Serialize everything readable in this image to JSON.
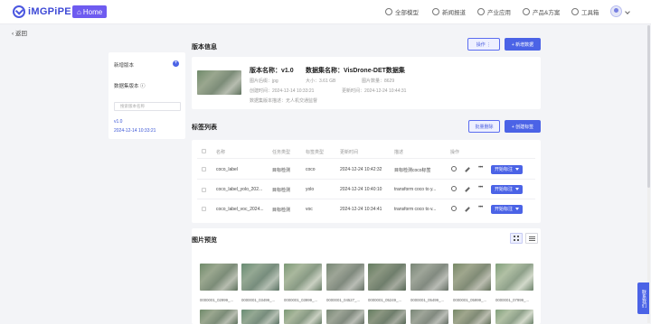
{
  "header": {
    "logo": "iMGPiPE",
    "home": "Home",
    "nav": [
      "全部模型",
      "新闻报道",
      "产业应用",
      "产品&方案",
      "工具箱"
    ]
  },
  "back": "返回",
  "sidebar": {
    "new_version": "新增版本",
    "dataset_version": "数据集版本 ⓘ",
    "search_placeholder": "搜索版本名称",
    "version": "v1.0",
    "version_time": "2024-12-14 10:33:21"
  },
  "version_info": {
    "title": "版本信息",
    "btn_action": "操作 ⋮",
    "btn_add": "+ 新增数据",
    "name": "版本名称：v1.0",
    "dataset": "数据集名称：VisDrone-DET数据集",
    "format": "图片后缀：jpg",
    "size": "大小：3.61 GB",
    "count": "图片数量：8629",
    "created": "创建时间：2024-12-14 10:33:21",
    "updated": "更新时间：2024-12-24 10:44:31",
    "desc": "数据集版本描述：无人机交通监督"
  },
  "labels": {
    "title": "标签列表",
    "btn_batch": "批量删除",
    "btn_create": "+ 创建标签",
    "columns": [
      "名称",
      "任务类型",
      "标签类型",
      "更新时间",
      "描述",
      "操作"
    ],
    "rows": [
      {
        "name": "coco_label",
        "task": "目标检测",
        "type": "coco",
        "time": "2024-12-24 10:42:32",
        "desc": "目标检测coco标签",
        "action": "开始标注"
      },
      {
        "name": "coco_label_yolo_202...",
        "task": "目标检测",
        "type": "yolo",
        "time": "2024-12-24 10:40:10",
        "desc": "transform coco to y...",
        "action": "开始标注"
      },
      {
        "name": "coco_label_voc_2024...",
        "task": "目标检测",
        "type": "voc",
        "time": "2024-12-24 10:34:41",
        "desc": "transform coco to v...",
        "action": "开始标注"
      }
    ]
  },
  "preview": {
    "title": "图片预览",
    "images": [
      "0000001_02999_...",
      "0000001_03499_...",
      "0000001_03999_...",
      "0000001_04527_...",
      "0000001_05249_...",
      "0000001_05499_...",
      "0000001_05999_...",
      "0000001_07999_..."
    ]
  },
  "side_tab": "联系我们",
  "colors": {
    "brand": "#4b63e6",
    "home": "#6e5bf0"
  }
}
